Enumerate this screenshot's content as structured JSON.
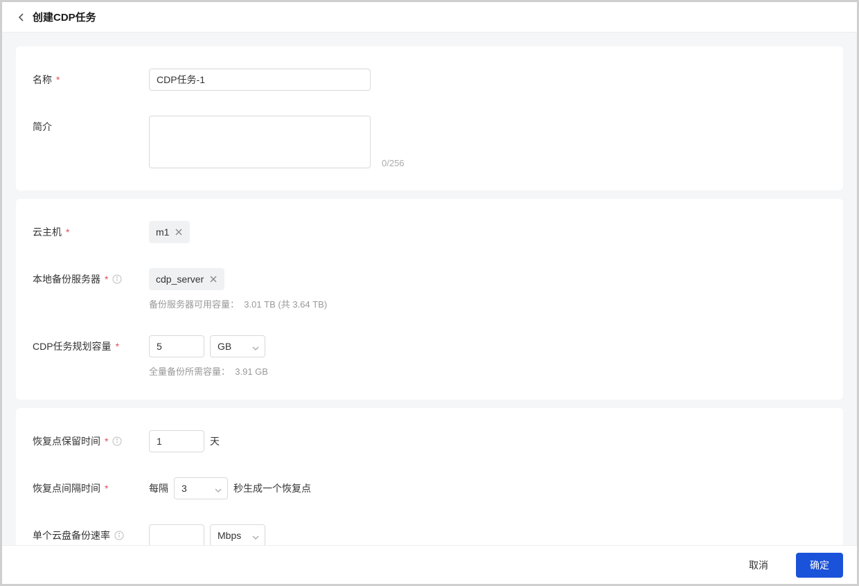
{
  "header": {
    "title": "创建CDP任务"
  },
  "section1": {
    "name_label": "名称",
    "name_value": "CDP任务-1",
    "desc_label": "简介",
    "desc_value": "",
    "desc_counter": "0/256"
  },
  "section2": {
    "vm_label": "云主机",
    "vm_tag": "m1",
    "server_label": "本地备份服务器",
    "server_tag": "cdp_server",
    "server_hint_label": "备份服务器可用容量：",
    "server_hint_value": "3.01 TB (共 3.64 TB)",
    "capacity_label": "CDP任务规划容量",
    "capacity_value": "5",
    "capacity_unit": "GB",
    "capacity_hint_label": "全量备份所需容量：",
    "capacity_hint_value": "3.91 GB"
  },
  "section3": {
    "retention_label": "恢复点保留时间",
    "retention_value": "1",
    "retention_unit": "天",
    "interval_label": "恢复点间隔时间",
    "interval_prefix": "每隔",
    "interval_value": "3",
    "interval_suffix": "秒生成一个恢复点",
    "speed_label": "单个云盘备份速率",
    "speed_value": "",
    "speed_unit": "Mbps"
  },
  "footer": {
    "cancel": "取消",
    "ok": "确定"
  }
}
